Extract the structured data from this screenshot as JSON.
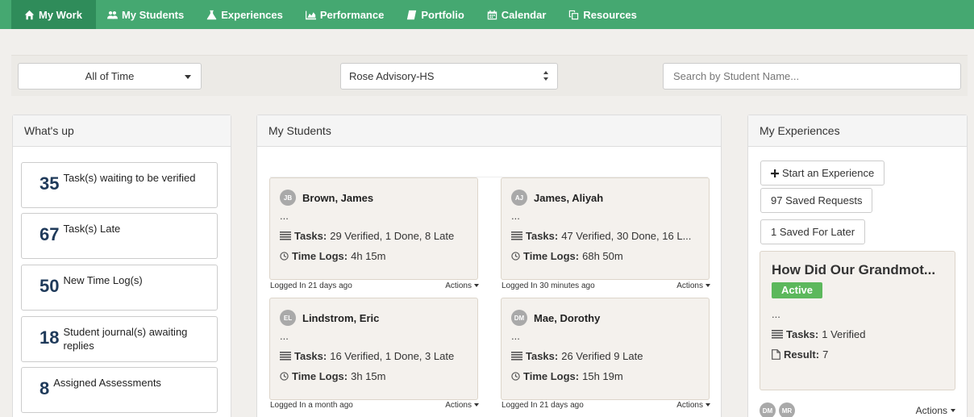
{
  "nav": [
    {
      "label": "My Work",
      "icon": "home-icon",
      "active": true
    },
    {
      "label": "My Students",
      "icon": "users-icon"
    },
    {
      "label": "Experiences",
      "icon": "flask-icon"
    },
    {
      "label": "Performance",
      "icon": "area-chart-icon"
    },
    {
      "label": "Portfolio",
      "icon": "book-icon"
    },
    {
      "label": "Calendar",
      "icon": "calendar-icon"
    },
    {
      "label": "Resources",
      "icon": "copy-icon"
    }
  ],
  "filters": {
    "range": "All of Time",
    "advisory": "Rose Advisory-HS",
    "search_placeholder": "Search by Student Name..."
  },
  "whatsup": {
    "title": "What's up",
    "cards": [
      {
        "count": "35",
        "label": "Task(s) waiting to be verified"
      },
      {
        "count": "67",
        "label": "Task(s) Late"
      },
      {
        "count": "50",
        "label": "New Time Log(s)"
      },
      {
        "count": "18",
        "label": "Student journal(s) awaiting replies"
      },
      {
        "count": "8",
        "label": "Assigned Assessments"
      }
    ]
  },
  "students": {
    "title": "My Students",
    "tasks_label": "Tasks:",
    "timelogs_label": "Time Logs:",
    "actions_label": "Actions",
    "items": [
      {
        "initials": "JB",
        "name": "Brown, James",
        "note": "...",
        "tasks": "29 Verified,  1 Done,  8 Late",
        "timelogs": "4h 15m",
        "logged_in": "Logged In 21 days ago"
      },
      {
        "initials": "AJ",
        "name": "James, Aliyah",
        "note": "...",
        "tasks": "47 Verified,  30 Done,  16 L...",
        "timelogs": "68h 50m",
        "logged_in": "Logged In 30 minutes ago"
      },
      {
        "initials": "EL",
        "name": "Lindstrom, Eric",
        "note": "...",
        "tasks": "16 Verified,  1 Done,  3 Late",
        "timelogs": "3h 15m",
        "logged_in": "Logged In a month ago"
      },
      {
        "initials": "DM",
        "name": "Mae, Dorothy",
        "note": "...",
        "tasks": "26 Verified 9 Late",
        "timelogs": "15h 19m",
        "logged_in": "Logged In 21 days ago"
      }
    ]
  },
  "experiences": {
    "title": "My Experiences",
    "start_label": "Start an Experience",
    "saved_requests": "97 Saved Requests",
    "saved_later": "1 Saved For Later",
    "card": {
      "title": "How Did Our Grandmot...",
      "status": "Active",
      "note": "...",
      "tasks_label": "Tasks:",
      "tasks": "1 Verified",
      "result_label": "Result:",
      "result": "7"
    },
    "avatars": [
      "DM",
      "MR"
    ],
    "actions_label": "Actions"
  },
  "colors": {
    "nav_bg": "#45a871",
    "nav_active": "#2f8c5a",
    "badge_green": "#5cb85c",
    "count_navy": "#1f3a5a"
  }
}
